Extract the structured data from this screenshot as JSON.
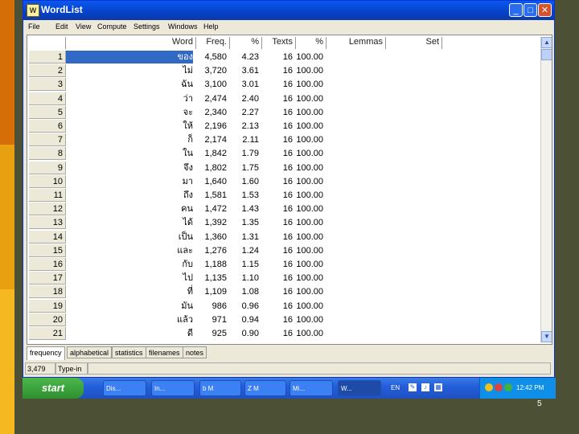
{
  "window": {
    "title": "WordList",
    "icon_label": "W"
  },
  "menu": [
    "File",
    "Edit",
    "View",
    "Compute",
    "Settings",
    "Windows",
    "Help"
  ],
  "headers": {
    "word": "Word",
    "freq": "Freq.",
    "pct": "%",
    "texts": "Texts",
    "pct2": "%",
    "lemmas": "Lemmas",
    "set": "Set"
  },
  "rows": [
    {
      "n": "1",
      "word": "ของ",
      "freq": "4,580",
      "pct": "4.23",
      "texts": "16",
      "pct2": "100.00"
    },
    {
      "n": "2",
      "word": "ไม่",
      "freq": "3,720",
      "pct": "3.61",
      "texts": "16",
      "pct2": "100.00"
    },
    {
      "n": "3",
      "word": "ฉัน",
      "freq": "3,100",
      "pct": "3.01",
      "texts": "16",
      "pct2": "100.00"
    },
    {
      "n": "4",
      "word": "ว่า",
      "freq": "2,474",
      "pct": "2.40",
      "texts": "16",
      "pct2": "100.00"
    },
    {
      "n": "5",
      "word": "จะ",
      "freq": "2,340",
      "pct": "2.27",
      "texts": "16",
      "pct2": "100.00"
    },
    {
      "n": "6",
      "word": "ให้",
      "freq": "2,196",
      "pct": "2.13",
      "texts": "16",
      "pct2": "100.00"
    },
    {
      "n": "7",
      "word": "ก็",
      "freq": "2,174",
      "pct": "2.11",
      "texts": "16",
      "pct2": "100.00"
    },
    {
      "n": "8",
      "word": "ใน",
      "freq": "1,842",
      "pct": "1.79",
      "texts": "16",
      "pct2": "100.00"
    },
    {
      "n": "9",
      "word": "จึง",
      "freq": "1,802",
      "pct": "1.75",
      "texts": "16",
      "pct2": "100.00"
    },
    {
      "n": "10",
      "word": "มา",
      "freq": "1,640",
      "pct": "1.60",
      "texts": "16",
      "pct2": "100.00"
    },
    {
      "n": "11",
      "word": "ถึง",
      "freq": "1,581",
      "pct": "1.53",
      "texts": "16",
      "pct2": "100.00"
    },
    {
      "n": "12",
      "word": "คน",
      "freq": "1,472",
      "pct": "1.43",
      "texts": "16",
      "pct2": "100.00"
    },
    {
      "n": "13",
      "word": "ได้",
      "freq": "1,392",
      "pct": "1.35",
      "texts": "16",
      "pct2": "100.00"
    },
    {
      "n": "14",
      "word": "เป็น",
      "freq": "1,360",
      "pct": "1.31",
      "texts": "16",
      "pct2": "100.00"
    },
    {
      "n": "15",
      "word": "และ",
      "freq": "1,276",
      "pct": "1.24",
      "texts": "16",
      "pct2": "100.00"
    },
    {
      "n": "16",
      "word": "กับ",
      "freq": "1,188",
      "pct": "1.15",
      "texts": "16",
      "pct2": "100.00"
    },
    {
      "n": "17",
      "word": "ไป",
      "freq": "1,135",
      "pct": "1.10",
      "texts": "16",
      "pct2": "100.00"
    },
    {
      "n": "18",
      "word": "ที่",
      "freq": "1,109",
      "pct": "1.08",
      "texts": "16",
      "pct2": "100.00"
    },
    {
      "n": "19",
      "word": "มัน",
      "freq": "986",
      "pct": "0.96",
      "texts": "16",
      "pct2": "100.00"
    },
    {
      "n": "20",
      "word": "แล้ว",
      "freq": "971",
      "pct": "0.94",
      "texts": "16",
      "pct2": "100.00"
    },
    {
      "n": "21",
      "word": "ดี",
      "freq": "925",
      "pct": "0.90",
      "texts": "16",
      "pct2": "100.00"
    }
  ],
  "tabs": [
    "frequency",
    "alphabetical",
    "statistics",
    "filenames",
    "notes"
  ],
  "status": {
    "count": "3,479",
    "type": "Type-in"
  },
  "taskbar": {
    "start": "start",
    "items": [
      "Dis...",
      "In...",
      "b M",
      "Z M",
      "Mi...",
      "W..."
    ],
    "lang": "EN",
    "clock": "12:42 PM"
  },
  "slide_number": "5",
  "colors": {
    "title": "#0a58ee",
    "selection": "#316ac5",
    "taskbar": "#245edb",
    "start": "#3a9a3a"
  }
}
